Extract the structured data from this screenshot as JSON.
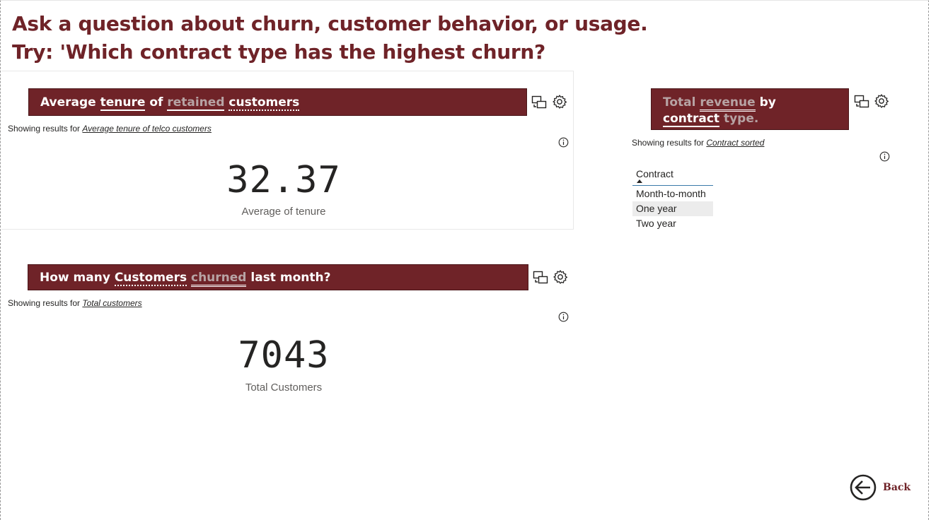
{
  "header": {
    "line1": "Ask a question about churn, customer behavior, or usage.",
    "line2": "Try: 'Which contract type has the highest churn?"
  },
  "qa_tenure": {
    "question_words": [
      "Average",
      "tenure",
      "of",
      "retained",
      "customers"
    ],
    "showing_prefix": "Showing results for",
    "showing_link": "Average tenure of telco customers",
    "value": "32.37",
    "label": "Average of tenure"
  },
  "qa_churned": {
    "question_words": [
      "How many",
      "Customers",
      "churned",
      "last month?"
    ],
    "showing_prefix": "Showing results for",
    "showing_link": "Total customers",
    "value": "7043",
    "label": "Total Customers"
  },
  "qa_revenue": {
    "question_words": [
      "Total",
      "revenue",
      "by",
      "contract",
      "type."
    ],
    "showing_prefix": "Showing results for",
    "showing_link": "Contract sorted",
    "table": {
      "header": "Contract",
      "rows": [
        "Month-to-month",
        "One year",
        "Two year"
      ],
      "highlighted_row": "One year"
    }
  },
  "back": {
    "label": "Back"
  },
  "icons": [
    "turn-into-visual-icon",
    "gear-icon",
    "info-icon",
    "back-arrow-icon"
  ],
  "colors": {
    "accent": "#6f2328",
    "dim_word": "#b7a3a4",
    "text": "#252423"
  }
}
